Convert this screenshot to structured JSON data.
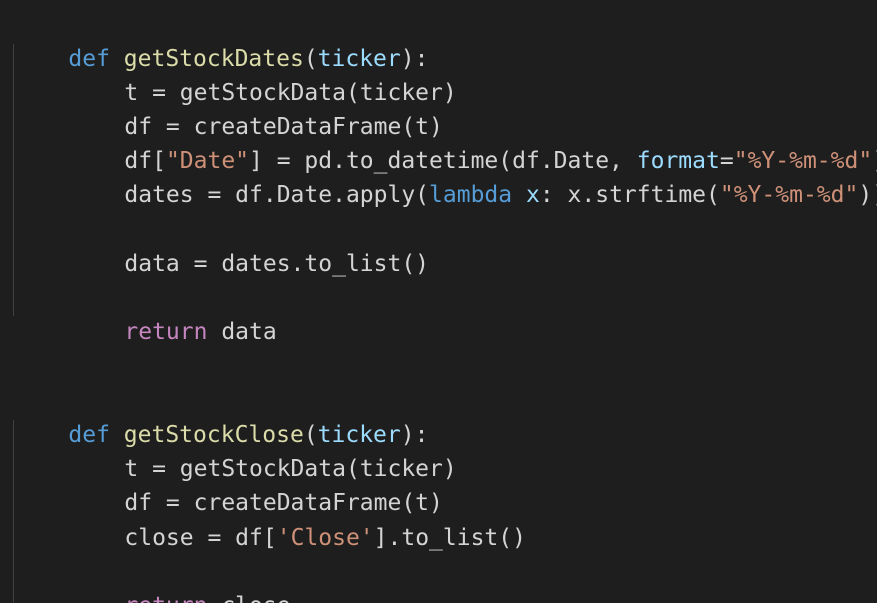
{
  "code_lines": [
    {
      "t0": "def",
      "t1": " ",
      "t2": "getStockDates",
      "t3": "(",
      "t4": "ticker",
      "t5": "):"
    },
    {
      "a": "t = getStockData(ticker)"
    },
    {
      "a": "df = createDataFrame(t)"
    },
    {
      "a0": "df[",
      "a1": "\"Date\"",
      "a2": "] = pd.to_datetime(df.Date, ",
      "a3": "format",
      "a4": "=",
      "a5": "\"%Y-%m-%d\"",
      "a6": ")"
    },
    {
      "b0": "dates = df.Date.apply(",
      "b1": "lambda",
      "b2": " ",
      "b3": "x",
      "b4": ": x.strftime(",
      "b5": "\"%Y-%m-%d\"",
      "b6": "))"
    },
    {
      "a": "data = dates.to_list()"
    },
    {
      "r0": "return",
      "r1": " data"
    },
    {
      "t0": "def",
      "t1": " ",
      "t2": "getStockClose",
      "t3": "(",
      "t4": "ticker",
      "t5": "):"
    },
    {
      "a": "t = getStockData(ticker)"
    },
    {
      "a": "df = createDataFrame(t)"
    },
    {
      "c0": "close = df[",
      "c1": "'Close'",
      "c2": "].to_list()"
    },
    {
      "r0": "return",
      "r1": " close"
    }
  ]
}
